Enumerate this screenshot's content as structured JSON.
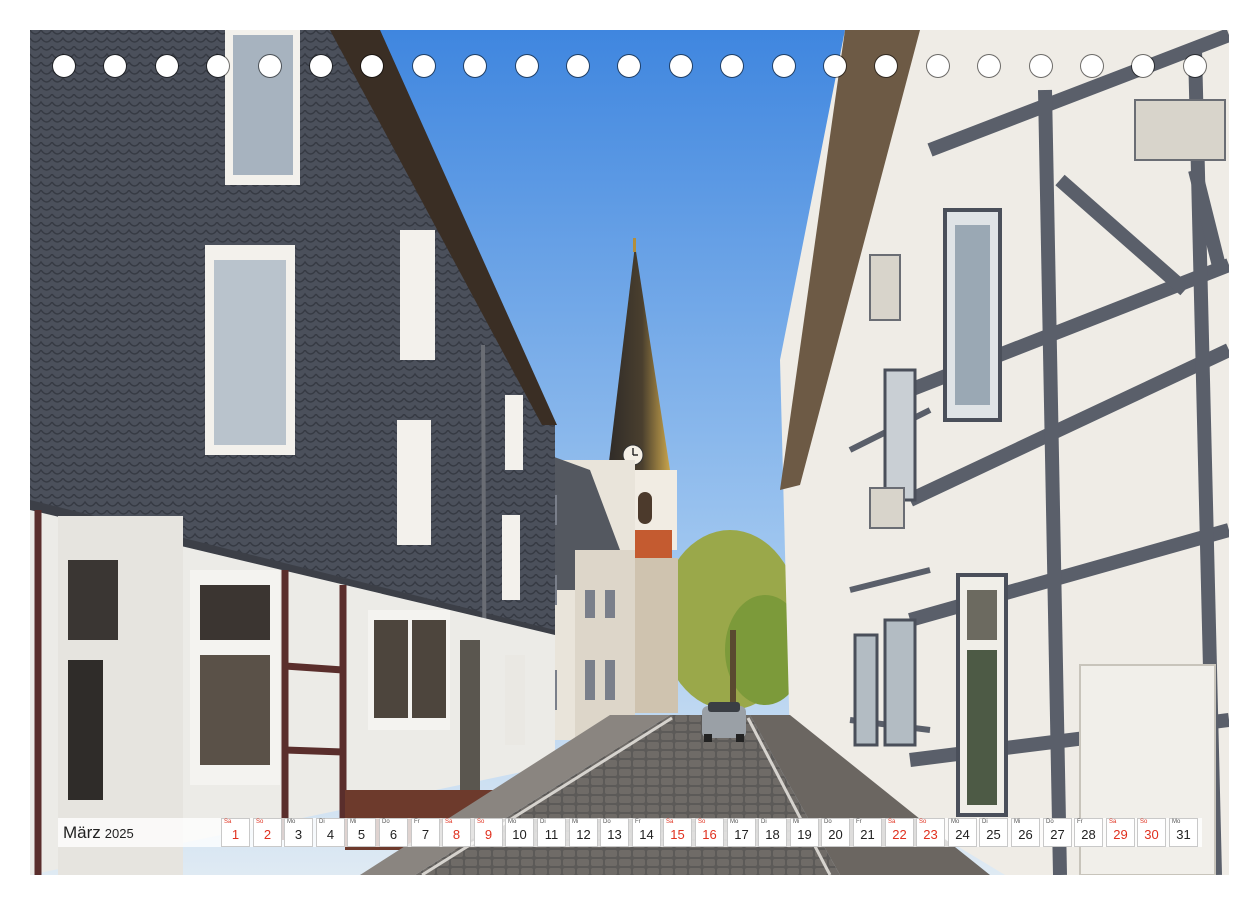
{
  "calendar": {
    "month": "März",
    "year": "2025",
    "days": [
      {
        "dn": "Sa",
        "num": "1",
        "weekend": true
      },
      {
        "dn": "So",
        "num": "2",
        "weekend": true
      },
      {
        "dn": "Mo",
        "num": "3",
        "weekend": false
      },
      {
        "dn": "Di",
        "num": "4",
        "weekend": false
      },
      {
        "dn": "Mi",
        "num": "5",
        "weekend": false
      },
      {
        "dn": "Do",
        "num": "6",
        "weekend": false
      },
      {
        "dn": "Fr",
        "num": "7",
        "weekend": false
      },
      {
        "dn": "Sa",
        "num": "8",
        "weekend": true
      },
      {
        "dn": "So",
        "num": "9",
        "weekend": true
      },
      {
        "dn": "Mo",
        "num": "10",
        "weekend": false
      },
      {
        "dn": "Di",
        "num": "11",
        "weekend": false
      },
      {
        "dn": "Mi",
        "num": "12",
        "weekend": false
      },
      {
        "dn": "Do",
        "num": "13",
        "weekend": false
      },
      {
        "dn": "Fr",
        "num": "14",
        "weekend": false
      },
      {
        "dn": "Sa",
        "num": "15",
        "weekend": true
      },
      {
        "dn": "So",
        "num": "16",
        "weekend": true
      },
      {
        "dn": "Mo",
        "num": "17",
        "weekend": false
      },
      {
        "dn": "Di",
        "num": "18",
        "weekend": false
      },
      {
        "dn": "Mi",
        "num": "19",
        "weekend": false
      },
      {
        "dn": "Do",
        "num": "20",
        "weekend": false
      },
      {
        "dn": "Fr",
        "num": "21",
        "weekend": false
      },
      {
        "dn": "Sa",
        "num": "22",
        "weekend": true
      },
      {
        "dn": "So",
        "num": "23",
        "weekend": true
      },
      {
        "dn": "Mo",
        "num": "24",
        "weekend": false
      },
      {
        "dn": "Di",
        "num": "25",
        "weekend": false
      },
      {
        "dn": "Mi",
        "num": "26",
        "weekend": false
      },
      {
        "dn": "Do",
        "num": "27",
        "weekend": false
      },
      {
        "dn": "Fr",
        "num": "28",
        "weekend": false
      },
      {
        "dn": "Sa",
        "num": "29",
        "weekend": true
      },
      {
        "dn": "So",
        "num": "30",
        "weekend": true
      },
      {
        "dn": "Mo",
        "num": "31",
        "weekend": false
      }
    ]
  },
  "colors": {
    "weekend": "#e0301e",
    "sky": "#6fa3e0",
    "slate": "#4a4f5a",
    "timber": "#5a5f6a"
  },
  "binding": {
    "hole_count": 23
  },
  "photo": {
    "clock_label": "clock"
  }
}
